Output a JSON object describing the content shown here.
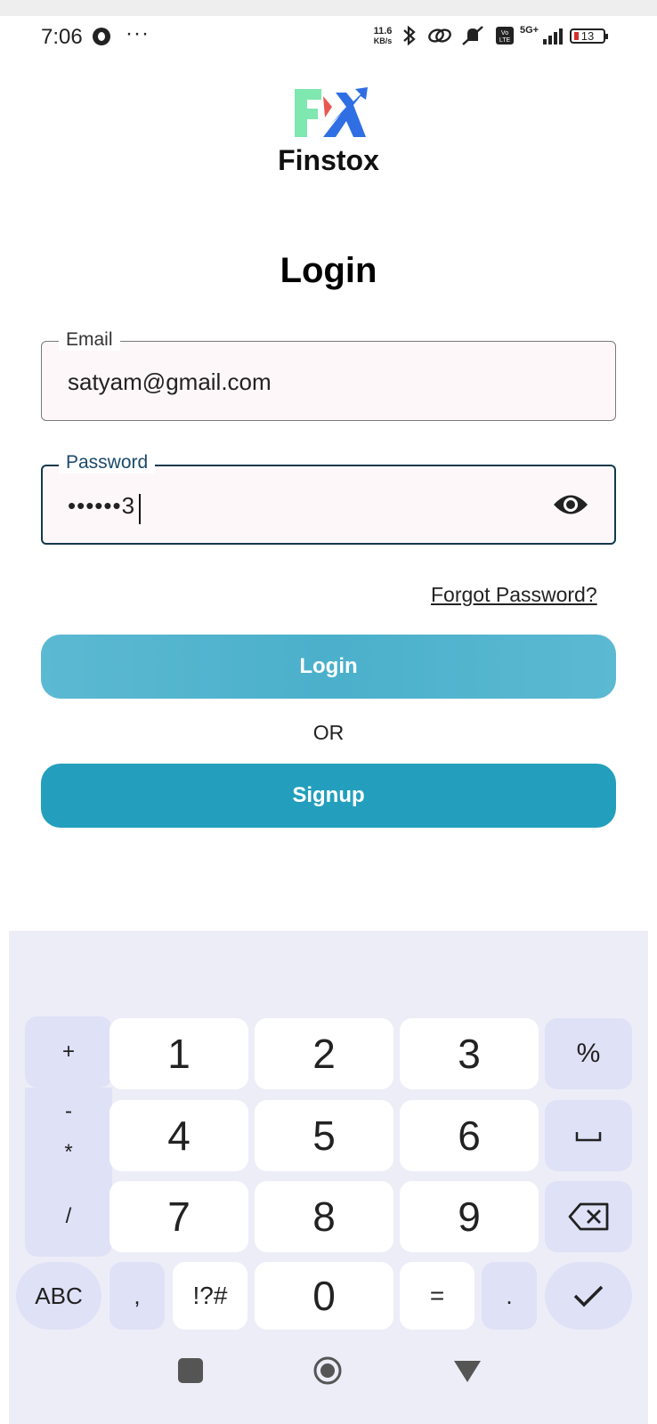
{
  "status_bar": {
    "time": "7:06",
    "overflow": "···",
    "net_speed_value": "11.6",
    "net_speed_unit": "KB/s",
    "network": "5G+",
    "battery": "13"
  },
  "app": {
    "brand_name": "Finstox",
    "heading": "Login",
    "email_label": "Email",
    "email_value": "satyam@gmail.com",
    "password_label": "Password",
    "password_value": "••••••3",
    "forgot_password": "Forgot Password?",
    "login_button": "Login",
    "or_separator": "OR",
    "signup_button": "Signup",
    "colors": {
      "login_button": "#55b5cf",
      "signup_button": "#239fbd",
      "focused_border": "#123a4a"
    }
  },
  "keyboard": {
    "left_keys": [
      "+",
      "-",
      "*",
      "/"
    ],
    "digits": [
      "1",
      "2",
      "3",
      "4",
      "5",
      "6",
      "7",
      "8",
      "9",
      "0"
    ],
    "percent": "%",
    "space_symbol": "␣",
    "abc": "ABC",
    "comma": ",",
    "symbols": "!?#",
    "equals": "=",
    "period": ".",
    "icons": [
      "backspace-icon",
      "check-icon",
      "space-icon"
    ]
  },
  "nav_bar": {
    "icons": [
      "recent-apps-icon",
      "home-icon",
      "back-icon"
    ]
  }
}
